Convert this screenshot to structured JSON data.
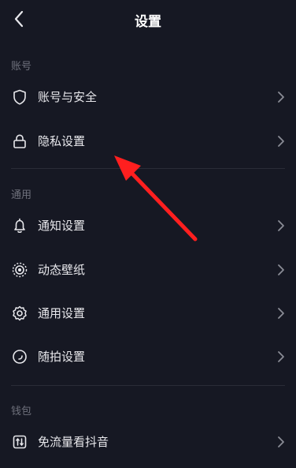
{
  "header": {
    "title": "设置"
  },
  "sections": {
    "account": {
      "label": "账号",
      "items": [
        {
          "label": "账号与安全",
          "icon": "shield-icon"
        },
        {
          "label": "隐私设置",
          "icon": "lock-icon"
        }
      ]
    },
    "general": {
      "label": "通用",
      "items": [
        {
          "label": "通知设置",
          "icon": "bell-icon"
        },
        {
          "label": "动态壁纸",
          "icon": "wallpaper-icon"
        },
        {
          "label": "通用设置",
          "icon": "gear-icon"
        },
        {
          "label": "随拍设置",
          "icon": "camera-circle-icon"
        }
      ]
    },
    "wallet": {
      "label": "钱包",
      "items": [
        {
          "label": "免流量看抖音",
          "icon": "data-free-icon"
        }
      ]
    }
  },
  "colors": {
    "background": "#161823",
    "text": "#e8e8ec",
    "section_label": "#6f717c",
    "annotation_arrow": "#ff1f1f"
  }
}
